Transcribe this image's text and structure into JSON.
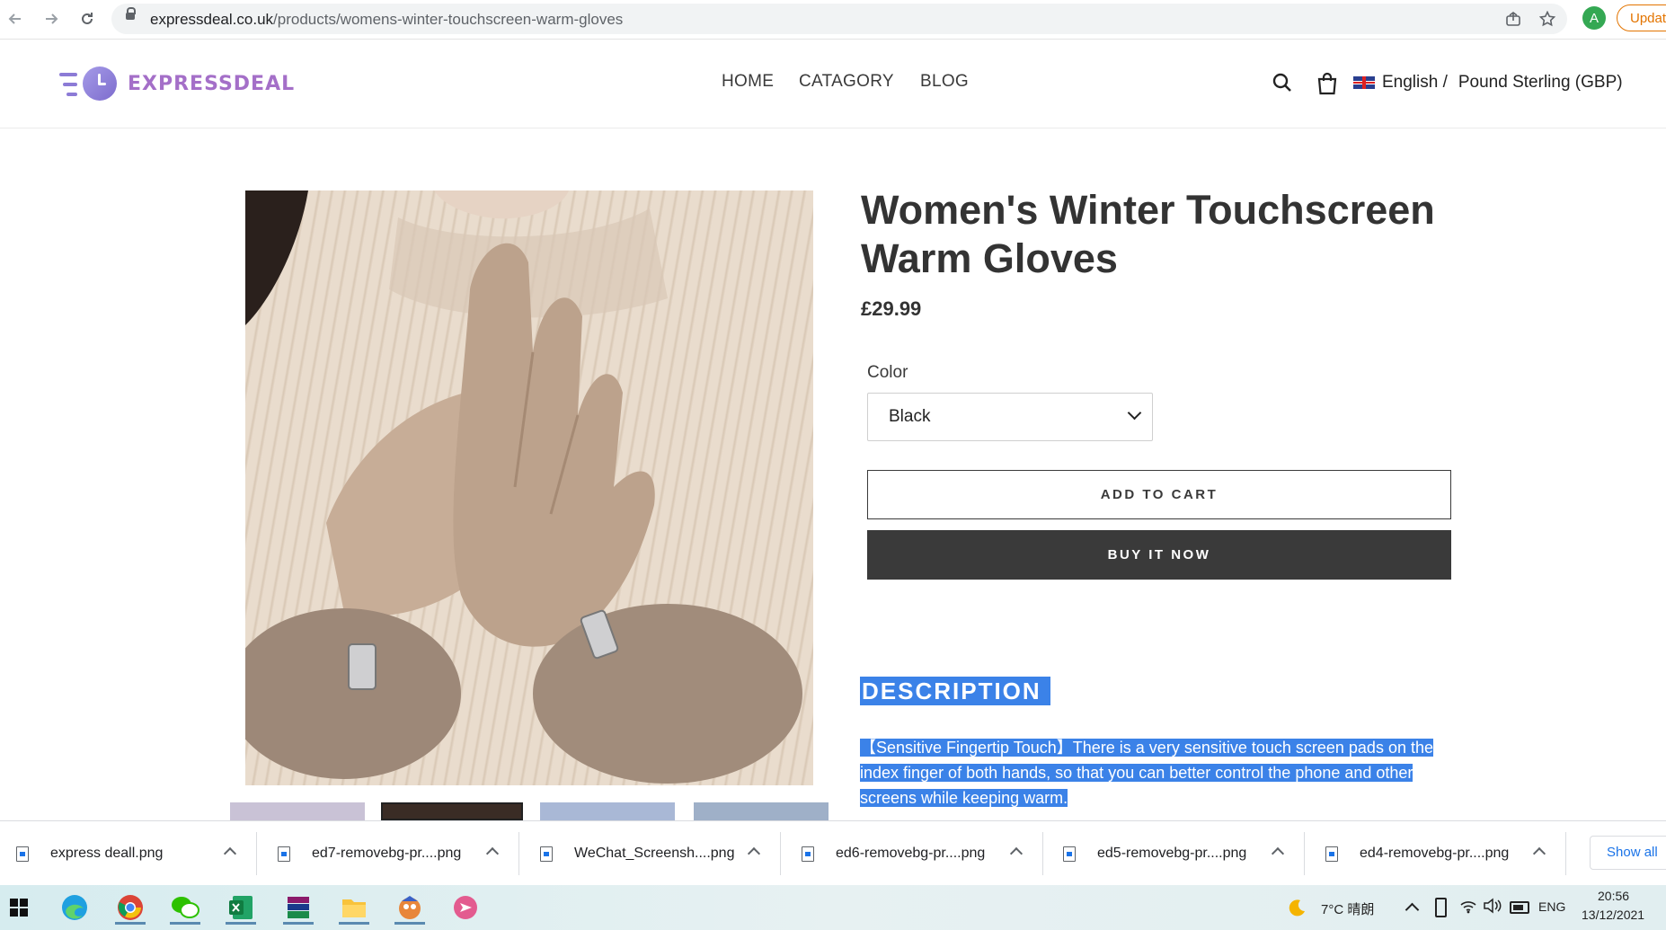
{
  "browser": {
    "url_domain": "expressdeal.co.uk",
    "url_path": "/products/womens-winter-touchscreen-warm-gloves",
    "profile_initial": "A",
    "update_label": "Updat",
    "icons": [
      "back-icon",
      "forward-icon",
      "reload-icon",
      "lock-icon",
      "share-icon",
      "bookmark-star-icon"
    ]
  },
  "site": {
    "logo_text": "EXPRESSDEAL",
    "nav": [
      "HOME",
      "CATAGORY",
      "BLOG"
    ],
    "language": "English /",
    "currency": "Pound Sterling (GBP)",
    "icons": [
      "search-icon",
      "cart-bag-icon",
      "uk-flag-icon"
    ]
  },
  "product": {
    "title": "Women's Winter Touchscreen Warm Gloves",
    "price": "£29.99",
    "color_label": "Color",
    "color_selected": "Black",
    "add_to_cart": "ADD TO CART",
    "buy_now": "BUY IT NOW",
    "description_heading": "DESCRIPTION",
    "description_text": "【Sensitive Fingertip Touch】There is a very sensitive touch screen pads on the index finger of both hands, so that you can better control the phone and other screens while keeping warm.",
    "highlight_color": "#3b82e8"
  },
  "downloads": {
    "items": [
      "express deall.png",
      "ed7-removebg-pr....png",
      "WeChat_Screensh....png",
      "ed6-removebg-pr....png",
      "ed5-removebg-pr....png",
      "ed4-removebg-pr....png"
    ],
    "show_all": "Show all"
  },
  "taskbar": {
    "apps": [
      "windows-start-icon",
      "edge-icon",
      "chrome-icon",
      "wechat-icon",
      "excel-icon",
      "winrar-icon",
      "file-explorer-icon",
      "game-icon",
      "app-icon"
    ],
    "weather": "7°C  晴朗",
    "language": "ENG",
    "time": "20:56",
    "date": "13/12/2021"
  }
}
